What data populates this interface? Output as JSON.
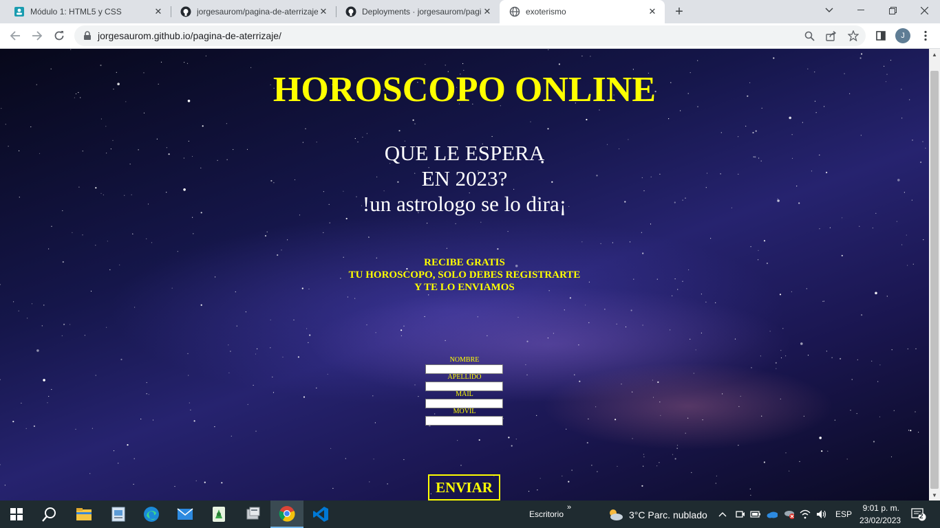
{
  "browser": {
    "tabs": [
      {
        "title": "Módulo 1: HTML5 y CSS",
        "icon": "course-icon"
      },
      {
        "title": "jorgesaurom/pagina-de-aterrizaje",
        "icon": "github-icon"
      },
      {
        "title": "Deployments · jorgesaurom/pagi",
        "icon": "github-icon"
      },
      {
        "title": "exoterismo",
        "icon": "globe-icon"
      }
    ],
    "url": "jorgesaurom.github.io/pagina-de-aterrizaje/",
    "profile_initial": "J"
  },
  "page": {
    "title": "HOROSCOPO ONLINE",
    "subtitle_lines": [
      "QUE LE ESPERA",
      "EN 2023?",
      "!un astrologo se lo dira¡"
    ],
    "promo_lines": [
      "RECIBE GRATIS",
      "TU HOROSCOPO, SOLO DEBES REGISTRARTE",
      "Y TE LO ENVIAMOS"
    ],
    "form": {
      "fields": [
        {
          "label": "NOMBRE",
          "value": ""
        },
        {
          "label": "APELLIDO",
          "value": ""
        },
        {
          "label": "MAIL",
          "value": ""
        },
        {
          "label": "MOVIL",
          "value": ""
        }
      ],
      "submit_label": "ENVIAR"
    },
    "colors": {
      "accent": "#ffff00",
      "text": "#ffffff"
    }
  },
  "taskbar": {
    "apps": [
      "windows-start-icon",
      "search-icon",
      "file-explorer-icon",
      "photos-icon",
      "edge-icon",
      "mail-icon",
      "app-icon",
      "app-icon",
      "chrome-icon",
      "vscode-icon"
    ],
    "desktop_label": "Escritorio",
    "weather": "3°C  Parc. nublado",
    "language": "ESP",
    "time": "9:01 p. m.",
    "date": "23/02/2023",
    "notifications": "2"
  }
}
